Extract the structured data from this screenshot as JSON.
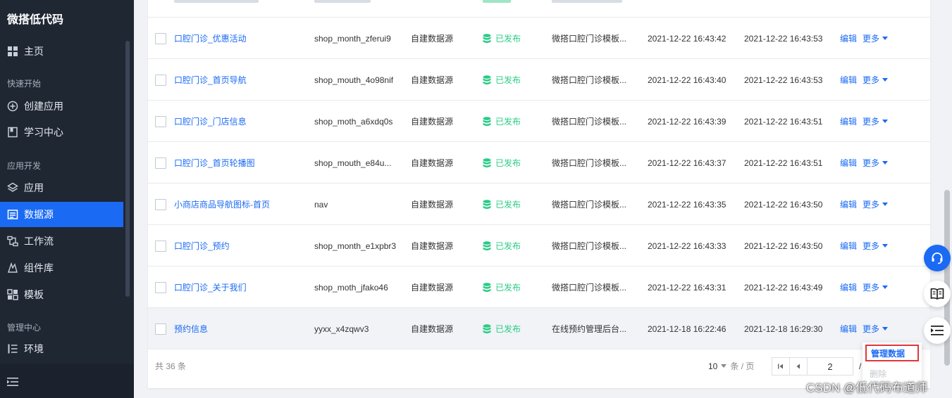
{
  "app": {
    "title": "微搭低代码"
  },
  "sidebar": {
    "items": [
      {
        "type": "item",
        "label": "主页",
        "icon": "grid-icon"
      },
      {
        "type": "section",
        "label": "快速开始"
      },
      {
        "type": "item",
        "label": "创建应用",
        "icon": "plus-circle-icon"
      },
      {
        "type": "item",
        "label": "学习中心",
        "icon": "book-icon"
      },
      {
        "type": "section",
        "label": "应用开发"
      },
      {
        "type": "item",
        "label": "应用",
        "icon": "layers-icon"
      },
      {
        "type": "item",
        "label": "数据源",
        "icon": "datasource-icon",
        "active": true
      },
      {
        "type": "item",
        "label": "工作流",
        "icon": "workflow-icon"
      },
      {
        "type": "item",
        "label": "组件库",
        "icon": "component-icon"
      },
      {
        "type": "item",
        "label": "模板",
        "icon": "template-icon"
      },
      {
        "type": "section",
        "label": "管理中心"
      },
      {
        "type": "item",
        "label": "环境",
        "icon": "env-icon"
      }
    ],
    "collapse_icon": "collapse-menu-icon"
  },
  "table": {
    "rows": [
      {
        "name": "口腔门诊_优惠活动",
        "id": "shop_month_zferui9",
        "source": "自建数据源",
        "status": "已发布",
        "desc": "微搭口腔门诊模板...",
        "created": "2021-12-22 16:43:42",
        "updated": "2021-12-22 16:43:53",
        "edit": "编辑",
        "more": "更多"
      },
      {
        "name": "口腔门诊_首页导航",
        "id": "shop_mouth_4o98nif",
        "source": "自建数据源",
        "status": "已发布",
        "desc": "微搭口腔门诊模板...",
        "created": "2021-12-22 16:43:40",
        "updated": "2021-12-22 16:43:53",
        "edit": "编辑",
        "more": "更多"
      },
      {
        "name": "口腔门诊_门店信息",
        "id": "shop_moth_a6xdq0s",
        "source": "自建数据源",
        "status": "已发布",
        "desc": "微搭口腔门诊模板...",
        "created": "2021-12-22 16:43:39",
        "updated": "2021-12-22 16:43:51",
        "edit": "编辑",
        "more": "更多"
      },
      {
        "name": "口腔门诊_首页轮播图",
        "id": "shop_mouth_e84u...",
        "source": "自建数据源",
        "status": "已发布",
        "desc": "微搭口腔门诊模板...",
        "created": "2021-12-22 16:43:37",
        "updated": "2021-12-22 16:43:51",
        "edit": "编辑",
        "more": "更多"
      },
      {
        "name": "小商店商品导航图标-首页",
        "id": "nav",
        "source": "自建数据源",
        "status": "已发布",
        "desc": "微搭口腔门诊模板...",
        "created": "2021-12-22 16:43:35",
        "updated": "2021-12-22 16:43:50",
        "edit": "编辑",
        "more": "更多"
      },
      {
        "name": "口腔门诊_预约",
        "id": "shop_month_e1xpbr3",
        "source": "自建数据源",
        "status": "已发布",
        "desc": "微搭口腔门诊模板...",
        "created": "2021-12-22 16:43:33",
        "updated": "2021-12-22 16:43:50",
        "edit": "编辑",
        "more": "更多"
      },
      {
        "name": "口腔门诊_关于我们",
        "id": "shop_moth_jfako46",
        "source": "自建数据源",
        "status": "已发布",
        "desc": "微搭口腔门诊模板...",
        "created": "2021-12-22 16:43:31",
        "updated": "2021-12-22 16:43:49",
        "edit": "编辑",
        "more": "更多"
      },
      {
        "name": "预约信息",
        "id": "yyxx_x4zqwv3",
        "source": "自建数据源",
        "status": "已发布",
        "desc": "在线预约管理后台...",
        "created": "2021-12-18 16:22:46",
        "updated": "2021-12-18 16:29:30",
        "edit": "编辑",
        "more": "更多",
        "hover": true
      }
    ]
  },
  "footer": {
    "total": "共 36 条",
    "page_size": "10",
    "page_size_unit": "条 / 页",
    "current_page": "2",
    "slash": "/"
  },
  "dropdown": {
    "manage_data": "管理数据",
    "delete": "删除"
  },
  "floating": {
    "support_icon": "headset-icon",
    "docs_icon": "open-book-icon",
    "outline_icon": "outline-list-icon"
  },
  "watermark": "CSDN @低代码布道师",
  "colors": {
    "primary": "#1a6af4",
    "sidebar": "#1f2733",
    "success": "#29cc85",
    "highlight": "#e0363c"
  }
}
